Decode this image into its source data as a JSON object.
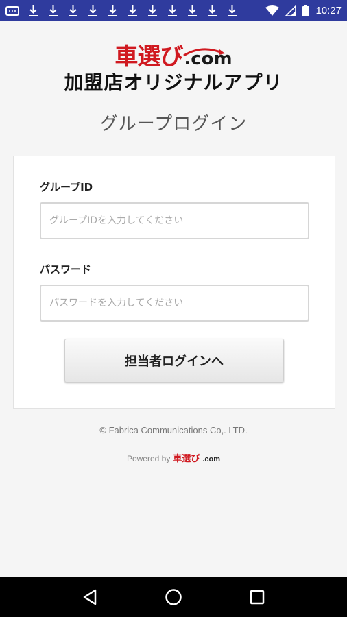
{
  "status_bar": {
    "time": "10:27",
    "notification_icons": [
      "message-icon",
      "download-icon",
      "download-icon",
      "download-icon",
      "download-icon",
      "download-icon",
      "download-icon",
      "download-icon",
      "download-icon",
      "download-icon",
      "download-icon",
      "download-icon"
    ],
    "right_icons": [
      "wifi-icon",
      "signal-icon",
      "battery-icon"
    ]
  },
  "header": {
    "logo_jp": "車選び",
    "logo_com": ".com",
    "app_title": "加盟店オリジナルアプリ",
    "page_title": "グループログイン"
  },
  "form": {
    "group_id_label": "グループID",
    "group_id_placeholder": "グループIDを入力してください",
    "group_id_value": "",
    "password_label": "パスワード",
    "password_placeholder": "パスワードを入力してください",
    "password_value": "",
    "submit_label": "担当者ログインへ"
  },
  "footer": {
    "copyright": "© Fabrica Communications Co,. LTD.",
    "powered_by": "Powered by",
    "powered_logo_jp": "車選び",
    "powered_logo_com": ".com"
  },
  "colors": {
    "status_bar": "#2f3b9e",
    "brand_red": "#d01920",
    "background": "#f5f5f5",
    "nav_bar": "#000000"
  },
  "nav_bar": {
    "icons": [
      "back-icon",
      "home-icon",
      "recents-icon"
    ]
  }
}
